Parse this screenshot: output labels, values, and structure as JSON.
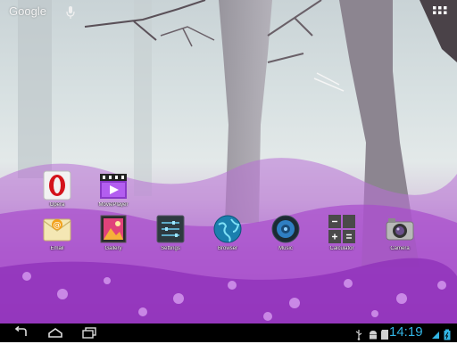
{
  "search": {
    "logo_text": "Google",
    "mic_icon": "mic-icon"
  },
  "launcher": {
    "apps_button_icon": "all-apps-grid-icon"
  },
  "desktop": {
    "row1": [
      {
        "label": "Opera",
        "icon": "opera-icon"
      },
      {
        "label": "MoviePlayer",
        "icon": "movie-player-icon"
      }
    ],
    "row2": [
      {
        "label": "Email",
        "icon": "email-icon"
      },
      {
        "label": "Gallery",
        "icon": "gallery-icon"
      },
      {
        "label": "Settings",
        "icon": "settings-icon"
      },
      {
        "label": "Browser",
        "icon": "browser-globe-icon"
      },
      {
        "label": "Music",
        "icon": "music-speaker-icon"
      },
      {
        "label": "Calculator",
        "icon": "calculator-icon"
      },
      {
        "label": "Camera",
        "icon": "camera-icon"
      }
    ]
  },
  "navbar": {
    "buttons": [
      "back-icon",
      "home-icon",
      "recent-apps-icon"
    ],
    "status_icons": [
      "usb-icon",
      "android-debug-icon",
      "sd-card-icon",
      "battery-icon"
    ],
    "clock": "14:19"
  },
  "colors": {
    "clock": "#33b5e5",
    "navbar_bg": "#000000",
    "label": "#ffffff"
  }
}
